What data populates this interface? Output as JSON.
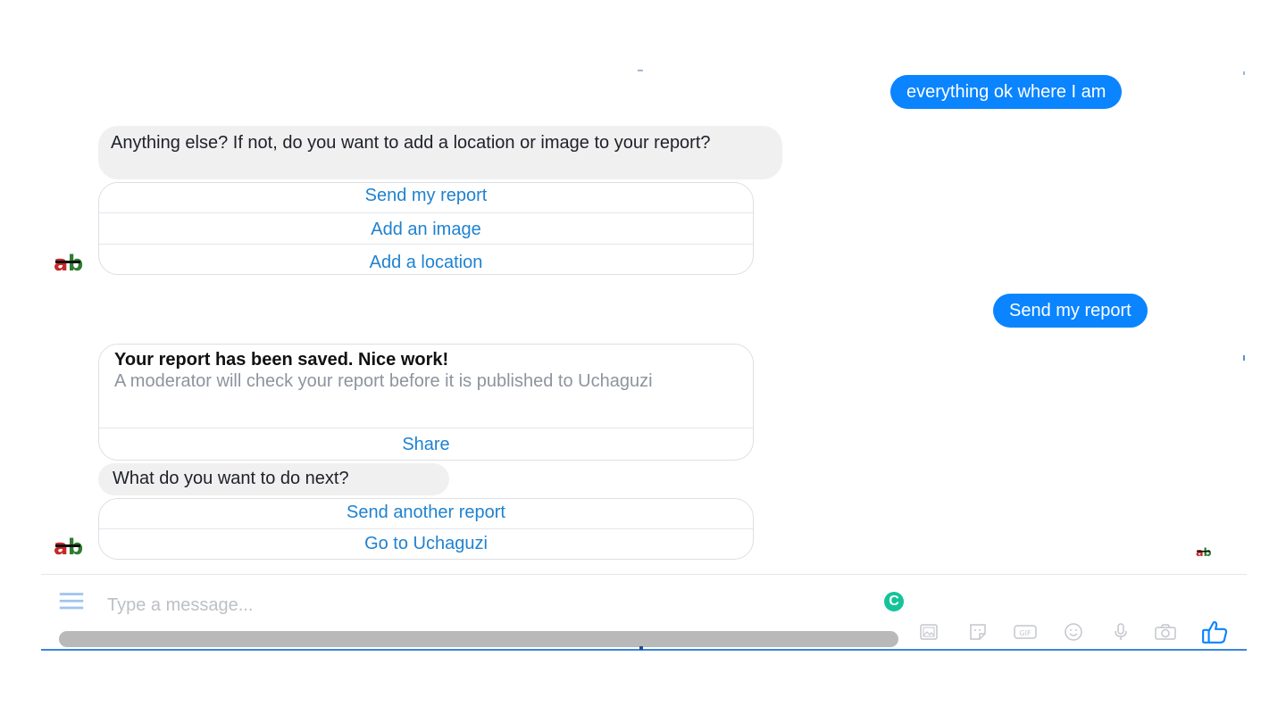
{
  "messages": {
    "user_1": "everything ok where I am",
    "bot_1": "Anything else? If not, do you want to add a location or image to your report?",
    "quick_replies_1": [
      "Send my report",
      "Add an image",
      "Add a location"
    ],
    "user_2": "Send my report",
    "card": {
      "title": "Your report has been saved. Nice work!",
      "subtitle": "A moderator will check your report before it is published to Uchaguzi",
      "button": "Share"
    },
    "bot_2": "What do you want to do next?",
    "quick_replies_2": [
      "Send another report",
      "Go to Uchaguzi"
    ]
  },
  "composer": {
    "placeholder": "Type a message..."
  },
  "icons": [
    "menu-icon",
    "grammarly-icon",
    "image-icon",
    "sticker-icon",
    "gif-icon",
    "emoji-icon",
    "microphone-icon",
    "camera-icon",
    "thumbs-up-icon"
  ],
  "colors": {
    "accent": "#0a84ff",
    "link": "#1f82d0",
    "bubble_in": "#f1f0f0"
  }
}
